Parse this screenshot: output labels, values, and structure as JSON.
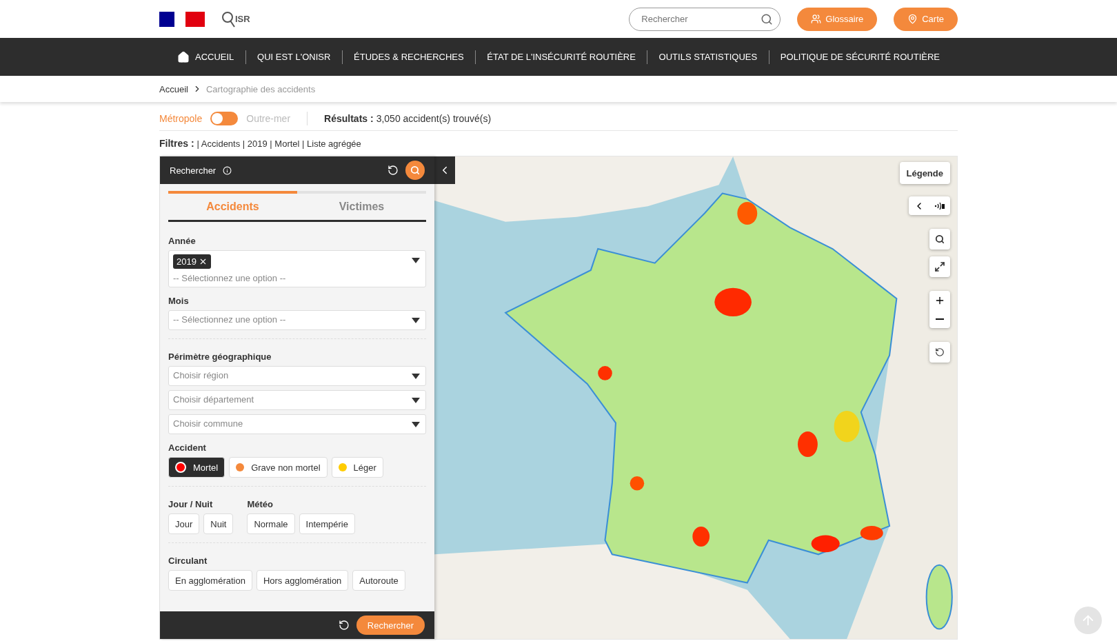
{
  "header": {
    "logo_text": "ISR",
    "search": {
      "placeholder": "Rechercher"
    },
    "buttons": [
      {
        "label": "Glossaire",
        "kind": "glossary"
      },
      {
        "label": "Carte",
        "kind": "map"
      }
    ]
  },
  "nav": [
    {
      "label": "ACCUEIL",
      "kind": "home"
    },
    {
      "label": "QUI EST L'ONISR",
      "kind": "link"
    },
    {
      "label": "ÉTUDES & RECHERCHES",
      "kind": "link"
    },
    {
      "label": "ÉTAT DE L'INSÉCURITÉ ROUTIÈRE",
      "kind": "link"
    },
    {
      "label": "OUTILS STATISTIQUES",
      "kind": "link"
    },
    {
      "label": "POLITIQUE DE SÉCURITÉ ROUTIÈRE",
      "kind": "link"
    }
  ],
  "breadcrumb": [
    {
      "label": "Accueil"
    },
    {
      "label": "Cartographie des accidents"
    }
  ],
  "territory": [
    {
      "label": "Métropole",
      "selected": true
    },
    {
      "label": "Outre-mer",
      "selected": false
    }
  ],
  "results": {
    "label": "Résultats :",
    "text": "3,050 accident(s) trouvé(s)"
  },
  "filters": {
    "label": "Filtres :",
    "text": "| Accidents | 2019 | Mortel | Liste agrégée"
  },
  "panel": {
    "title": "Rechercher",
    "tabs": [
      {
        "label": "Accidents",
        "selected": true
      },
      {
        "label": "Victimes",
        "selected": false
      }
    ],
    "year": {
      "label": "Année",
      "tags": [
        "2019"
      ],
      "placeholder": "-- Sélectionnez une option --"
    },
    "month": {
      "label": "Mois",
      "placeholder": "-- Sélectionnez une option --"
    },
    "perimeter": {
      "label": "Périmètre géographique",
      "selects": [
        {
          "placeholder": "Choisir région"
        },
        {
          "placeholder": "Choisir département"
        },
        {
          "placeholder": "Choisir commune"
        }
      ]
    },
    "accident": {
      "label": "Accident",
      "options": [
        {
          "label": "Mortel",
          "color": "#ff0000",
          "selected": true
        },
        {
          "label": "Grave non mortel",
          "color": "#f4893c",
          "selected": false
        },
        {
          "label": "Léger",
          "color": "#ffcc00",
          "selected": false
        }
      ]
    },
    "day_night": {
      "label": "Jour / Nuit",
      "options": [
        {
          "label": "Jour",
          "selected": false
        },
        {
          "label": "Nuit",
          "selected": false
        }
      ]
    },
    "weather": {
      "label": "Météo",
      "options": [
        {
          "label": "Normale",
          "selected": false
        },
        {
          "label": "Intempérie",
          "selected": false
        }
      ]
    },
    "traffic": {
      "label": "Circulant",
      "options": [
        {
          "label": "En agglomération",
          "selected": false
        },
        {
          "label": "Hors agglomération",
          "selected": false
        },
        {
          "label": "Autoroute",
          "selected": false
        }
      ]
    },
    "submit": "Rechercher"
  },
  "map": {
    "kind": "picture",
    "legend_button": "Légende"
  }
}
